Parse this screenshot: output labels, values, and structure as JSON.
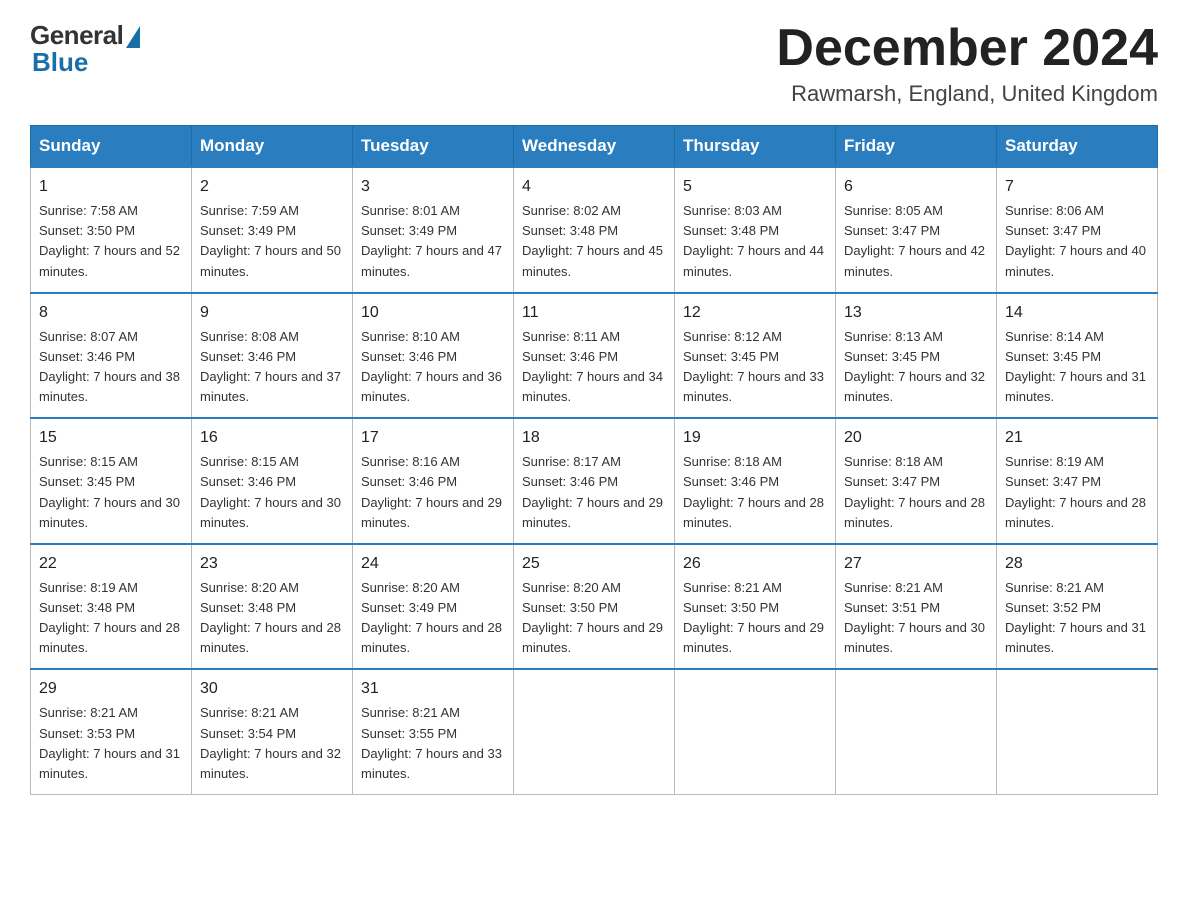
{
  "header": {
    "logo": {
      "general": "General",
      "blue": "Blue"
    },
    "title": "December 2024",
    "location": "Rawmarsh, England, United Kingdom"
  },
  "days_of_week": [
    "Sunday",
    "Monday",
    "Tuesday",
    "Wednesday",
    "Thursday",
    "Friday",
    "Saturday"
  ],
  "weeks": [
    [
      {
        "day": "1",
        "sunrise": "7:58 AM",
        "sunset": "3:50 PM",
        "daylight": "7 hours and 52 minutes."
      },
      {
        "day": "2",
        "sunrise": "7:59 AM",
        "sunset": "3:49 PM",
        "daylight": "7 hours and 50 minutes."
      },
      {
        "day": "3",
        "sunrise": "8:01 AM",
        "sunset": "3:49 PM",
        "daylight": "7 hours and 47 minutes."
      },
      {
        "day": "4",
        "sunrise": "8:02 AM",
        "sunset": "3:48 PM",
        "daylight": "7 hours and 45 minutes."
      },
      {
        "day": "5",
        "sunrise": "8:03 AM",
        "sunset": "3:48 PM",
        "daylight": "7 hours and 44 minutes."
      },
      {
        "day": "6",
        "sunrise": "8:05 AM",
        "sunset": "3:47 PM",
        "daylight": "7 hours and 42 minutes."
      },
      {
        "day": "7",
        "sunrise": "8:06 AM",
        "sunset": "3:47 PM",
        "daylight": "7 hours and 40 minutes."
      }
    ],
    [
      {
        "day": "8",
        "sunrise": "8:07 AM",
        "sunset": "3:46 PM",
        "daylight": "7 hours and 38 minutes."
      },
      {
        "day": "9",
        "sunrise": "8:08 AM",
        "sunset": "3:46 PM",
        "daylight": "7 hours and 37 minutes."
      },
      {
        "day": "10",
        "sunrise": "8:10 AM",
        "sunset": "3:46 PM",
        "daylight": "7 hours and 36 minutes."
      },
      {
        "day": "11",
        "sunrise": "8:11 AM",
        "sunset": "3:46 PM",
        "daylight": "7 hours and 34 minutes."
      },
      {
        "day": "12",
        "sunrise": "8:12 AM",
        "sunset": "3:45 PM",
        "daylight": "7 hours and 33 minutes."
      },
      {
        "day": "13",
        "sunrise": "8:13 AM",
        "sunset": "3:45 PM",
        "daylight": "7 hours and 32 minutes."
      },
      {
        "day": "14",
        "sunrise": "8:14 AM",
        "sunset": "3:45 PM",
        "daylight": "7 hours and 31 minutes."
      }
    ],
    [
      {
        "day": "15",
        "sunrise": "8:15 AM",
        "sunset": "3:45 PM",
        "daylight": "7 hours and 30 minutes."
      },
      {
        "day": "16",
        "sunrise": "8:15 AM",
        "sunset": "3:46 PM",
        "daylight": "7 hours and 30 minutes."
      },
      {
        "day": "17",
        "sunrise": "8:16 AM",
        "sunset": "3:46 PM",
        "daylight": "7 hours and 29 minutes."
      },
      {
        "day": "18",
        "sunrise": "8:17 AM",
        "sunset": "3:46 PM",
        "daylight": "7 hours and 29 minutes."
      },
      {
        "day": "19",
        "sunrise": "8:18 AM",
        "sunset": "3:46 PM",
        "daylight": "7 hours and 28 minutes."
      },
      {
        "day": "20",
        "sunrise": "8:18 AM",
        "sunset": "3:47 PM",
        "daylight": "7 hours and 28 minutes."
      },
      {
        "day": "21",
        "sunrise": "8:19 AM",
        "sunset": "3:47 PM",
        "daylight": "7 hours and 28 minutes."
      }
    ],
    [
      {
        "day": "22",
        "sunrise": "8:19 AM",
        "sunset": "3:48 PM",
        "daylight": "7 hours and 28 minutes."
      },
      {
        "day": "23",
        "sunrise": "8:20 AM",
        "sunset": "3:48 PM",
        "daylight": "7 hours and 28 minutes."
      },
      {
        "day": "24",
        "sunrise": "8:20 AM",
        "sunset": "3:49 PM",
        "daylight": "7 hours and 28 minutes."
      },
      {
        "day": "25",
        "sunrise": "8:20 AM",
        "sunset": "3:50 PM",
        "daylight": "7 hours and 29 minutes."
      },
      {
        "day": "26",
        "sunrise": "8:21 AM",
        "sunset": "3:50 PM",
        "daylight": "7 hours and 29 minutes."
      },
      {
        "day": "27",
        "sunrise": "8:21 AM",
        "sunset": "3:51 PM",
        "daylight": "7 hours and 30 minutes."
      },
      {
        "day": "28",
        "sunrise": "8:21 AM",
        "sunset": "3:52 PM",
        "daylight": "7 hours and 31 minutes."
      }
    ],
    [
      {
        "day": "29",
        "sunrise": "8:21 AM",
        "sunset": "3:53 PM",
        "daylight": "7 hours and 31 minutes."
      },
      {
        "day": "30",
        "sunrise": "8:21 AM",
        "sunset": "3:54 PM",
        "daylight": "7 hours and 32 minutes."
      },
      {
        "day": "31",
        "sunrise": "8:21 AM",
        "sunset": "3:55 PM",
        "daylight": "7 hours and 33 minutes."
      },
      null,
      null,
      null,
      null
    ]
  ]
}
